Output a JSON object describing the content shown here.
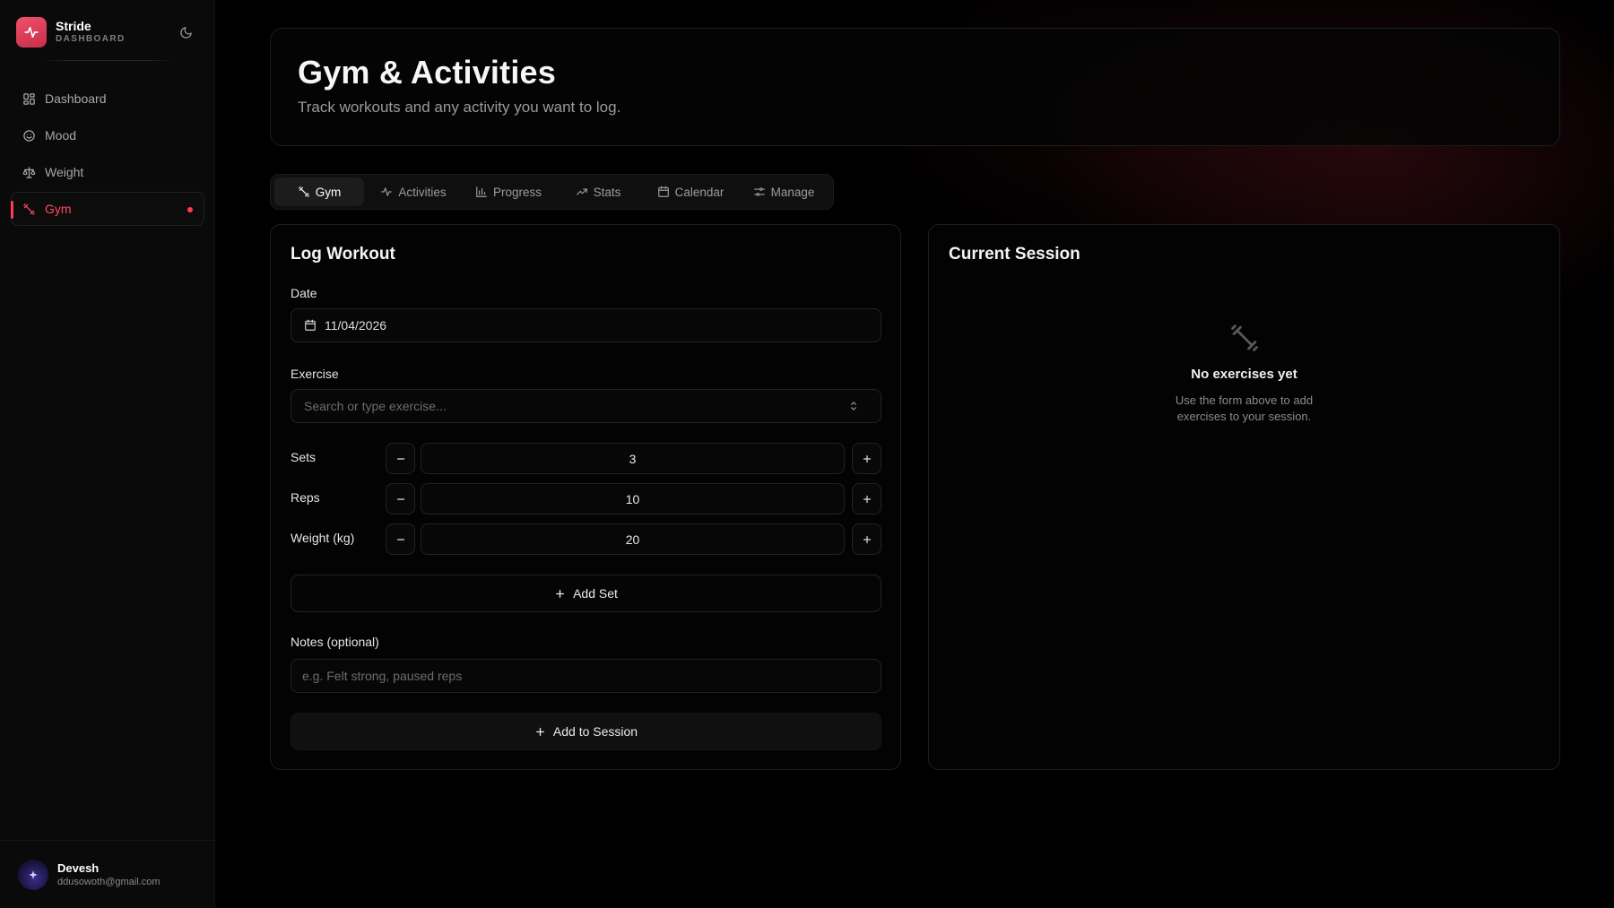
{
  "brand": {
    "name": "Stride",
    "subtitle": "DASHBOARD"
  },
  "sidebar": {
    "items": [
      {
        "label": "Dashboard",
        "icon": "grid-icon",
        "active": false
      },
      {
        "label": "Mood",
        "icon": "smile-icon",
        "active": false
      },
      {
        "label": "Weight",
        "icon": "scale-icon",
        "active": false
      },
      {
        "label": "Gym",
        "icon": "dumbbell-icon",
        "active": true
      }
    ]
  },
  "user": {
    "name": "Devesh",
    "email": "ddusowoth@gmail.com"
  },
  "header": {
    "title": "Gym & Activities",
    "subtitle": "Track workouts and any activity you want to log."
  },
  "tabs": [
    {
      "label": "Gym",
      "icon": "dumbbell-icon",
      "active": true
    },
    {
      "label": "Activities",
      "icon": "activity-icon",
      "active": false
    },
    {
      "label": "Progress",
      "icon": "bar-chart-icon",
      "active": false
    },
    {
      "label": "Stats",
      "icon": "trending-up-icon",
      "active": false
    },
    {
      "label": "Calendar",
      "icon": "calendar-icon",
      "active": false
    },
    {
      "label": "Manage",
      "icon": "sliders-icon",
      "active": false
    }
  ],
  "log_workout": {
    "title": "Log Workout",
    "date": {
      "label": "Date",
      "value": "11/04/2026"
    },
    "exercise": {
      "label": "Exercise",
      "placeholder": "Search or type exercise..."
    },
    "sets": {
      "label": "Sets",
      "value": "3"
    },
    "reps": {
      "label": "Reps",
      "value": "10"
    },
    "weight": {
      "label": "Weight (kg)",
      "value": "20"
    },
    "add_set_label": "Add Set",
    "notes": {
      "label": "Notes (optional)",
      "placeholder": "e.g. Felt strong, paused reps"
    },
    "add_to_session_label": "Add to Session"
  },
  "session": {
    "title": "Current Session",
    "empty_title": "No exercises yet",
    "empty_desc": "Use the form above to add exercises to your session."
  },
  "colors": {
    "accent": "#ff3b52",
    "brand_gradient_start": "#f0506a",
    "brand_gradient_end": "#c72e4a",
    "background": "#000000"
  }
}
